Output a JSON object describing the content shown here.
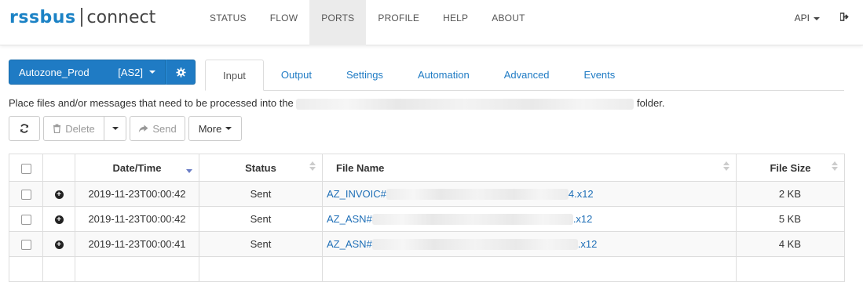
{
  "brand": {
    "part1": "rssbus",
    "part2": "connect"
  },
  "nav": {
    "items": [
      {
        "label": "STATUS",
        "active": false
      },
      {
        "label": "FLOW",
        "active": false
      },
      {
        "label": "PORTS",
        "active": true
      },
      {
        "label": "PROFILE",
        "active": false
      },
      {
        "label": "HELP",
        "active": false
      },
      {
        "label": "ABOUT",
        "active": false
      }
    ],
    "api_label": "API",
    "logout_icon": "sign-out-icon"
  },
  "port": {
    "name": "Autozone_Prod",
    "type": "[AS2]",
    "gear_icon": "gear-icon"
  },
  "tabs": [
    {
      "label": "Input",
      "active": true
    },
    {
      "label": "Output"
    },
    {
      "label": "Settings"
    },
    {
      "label": "Automation"
    },
    {
      "label": "Advanced"
    },
    {
      "label": "Events"
    }
  ],
  "description": {
    "prefix": "Place files and/or messages that need to be processed into the",
    "suffix": "folder."
  },
  "toolbar": {
    "refresh_icon": "refresh-icon",
    "delete_label": "Delete",
    "send_label": "Send",
    "more_label": "More"
  },
  "table": {
    "columns": [
      "Date/Time",
      "Status",
      "File Name",
      "File Size"
    ],
    "rows": [
      {
        "datetime": "2019-11-23T00:00:42",
        "status": "Sent",
        "file_prefix": "AZ_INVOIC#",
        "file_suffix": "4.x12",
        "size": "2 KB"
      },
      {
        "datetime": "2019-11-23T00:00:42",
        "status": "Sent",
        "file_prefix": "AZ_ASN#",
        "file_suffix": ".x12",
        "size": "5 KB"
      },
      {
        "datetime": "2019-11-23T00:00:41",
        "status": "Sent",
        "file_prefix": "AZ_ASN#",
        "file_suffix": ".x12",
        "size": "4 KB"
      }
    ]
  },
  "colors": {
    "accent": "#1f7bc4",
    "link": "#1f6fb7",
    "sent": "#3c7a3c"
  }
}
